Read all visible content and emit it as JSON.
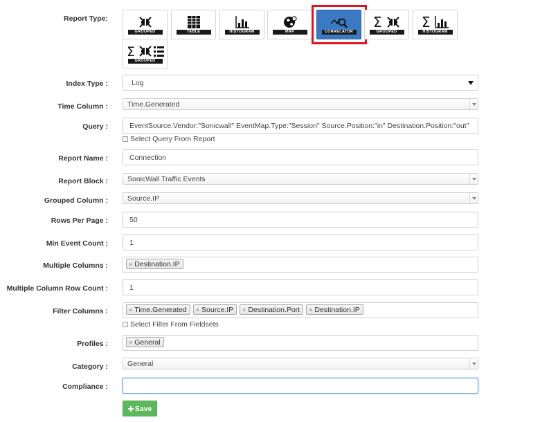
{
  "report_type": {
    "label": "Report Type:",
    "options": [
      {
        "caption": "GROUPED",
        "icon": "grouped-icon"
      },
      {
        "caption": "TABLE",
        "icon": "table-icon"
      },
      {
        "caption": "HISTOGRAM",
        "icon": "histogram-icon"
      },
      {
        "caption": "MAP",
        "icon": "map-icon"
      },
      {
        "caption": "CORRELATOR",
        "icon": "correlator-icon",
        "selected": true
      },
      {
        "caption": "GROUPED",
        "icon": "sum-grouped-icon"
      },
      {
        "caption": "HISTOGRAM",
        "icon": "sum-histogram-icon"
      },
      {
        "caption": "GROUPED",
        "icon": "sum-grouped-list-icon"
      }
    ]
  },
  "index_type": {
    "label": "Index Type :",
    "value": "Log"
  },
  "time_column": {
    "label": "Time Column :",
    "value": "Time.Generated"
  },
  "query": {
    "label": "Query :",
    "value": "EventSource.Vendor:\"Sonicwall\" EventMap.Type:\"Session\" Source.Position:\"in\" Destination.Position:\"out\"",
    "checkbox_label": "Select Query From Report"
  },
  "report_name": {
    "label": "Report Name :",
    "value": "Connection"
  },
  "report_block": {
    "label": "Report Block :",
    "value": "SonicWall Traffic Events"
  },
  "grouped_column": {
    "label": "Grouped Column :",
    "value": "Source.IP"
  },
  "rows_per_page": {
    "label": "Rows Per Page :",
    "value": "50"
  },
  "min_event_count": {
    "label": "Min Event Count :",
    "value": "1"
  },
  "multiple_columns": {
    "label": "Multiple Columns :",
    "tags": [
      "Destination.IP"
    ]
  },
  "multiple_column_row_count": {
    "label": "Multiple Column Row Count :",
    "value": "1"
  },
  "filter_columns": {
    "label": "Filter Columns :",
    "tags": [
      "Time.Generated",
      "Source.IP",
      "Destination.Port",
      "Destination.IP"
    ],
    "checkbox_label": "Select Filter From Fieldsets"
  },
  "profiles": {
    "label": "Profiles :",
    "tags": [
      "General"
    ]
  },
  "category": {
    "label": "Category :",
    "value": "General"
  },
  "compliance": {
    "label": "Compliance :",
    "value": ""
  },
  "save": {
    "label": "Save",
    "icon": "plus-icon"
  },
  "tag_remove_glyph": "×",
  "colors": {
    "selected": "#3a7ac2",
    "highlight": "#e3111d",
    "save": "#5cb85c"
  }
}
